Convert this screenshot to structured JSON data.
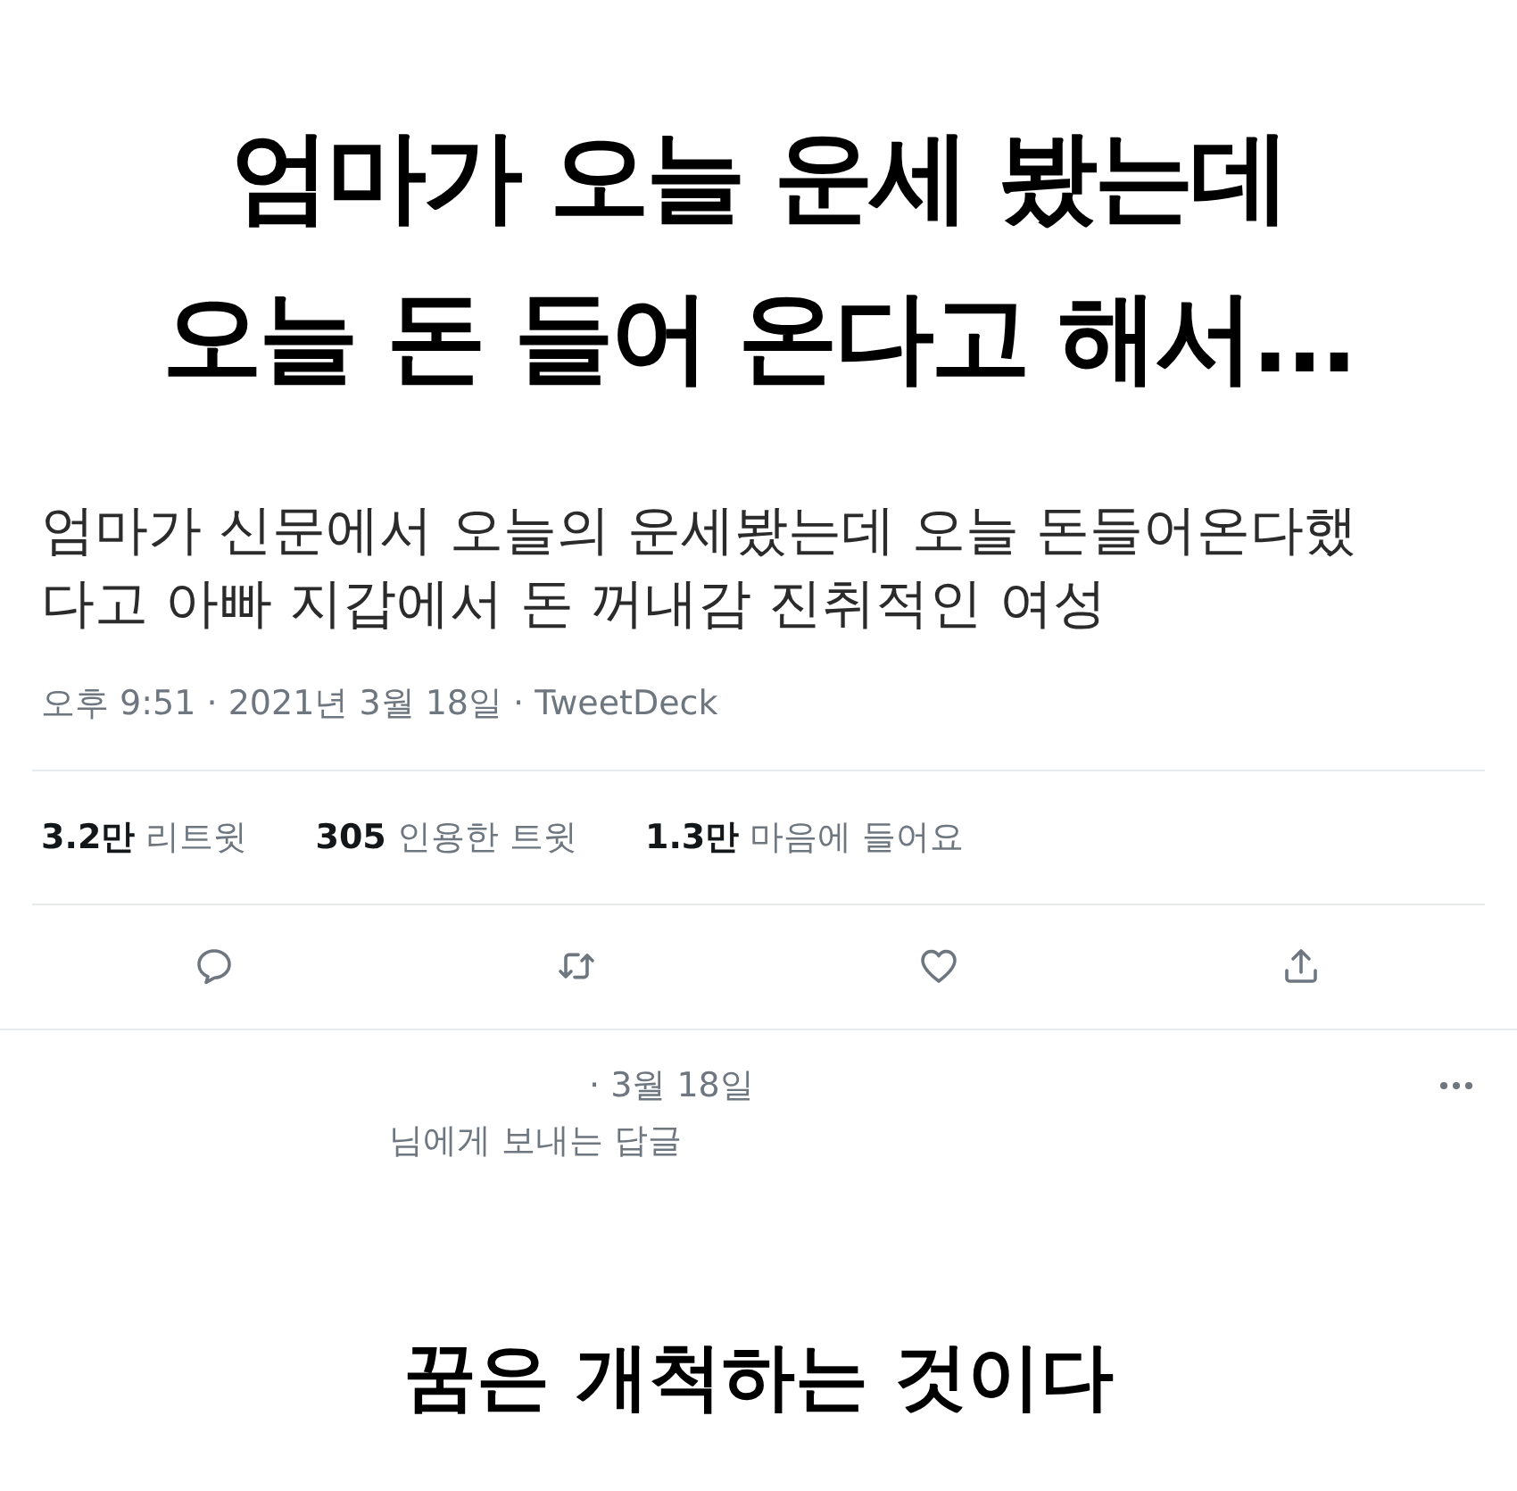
{
  "headline": {
    "lines": [
      "엄마가 오늘 운세 봤는데",
      "오늘 돈 들어 온다고 해서..."
    ]
  },
  "tweet": {
    "text": "엄마가 신문에서 오늘의 운세봤는데 오늘 돈들어온다했다고 아빠 지갑에서 돈 꺼내감 진취적인 여성",
    "meta": "오후 9:51 · 2021년 3월 18일 · TweetDeck",
    "stats": [
      {
        "count": "3.2만",
        "label": "리트윗"
      },
      {
        "count": "305",
        "label": "인용한 트윗"
      },
      {
        "count": "1.3만",
        "label": "마음에 들어요"
      }
    ]
  },
  "reply": {
    "date": "· 3월 18일",
    "replying_to": "님에게 보내는 답글"
  },
  "caption": "꿈은 개척하는 것이다"
}
